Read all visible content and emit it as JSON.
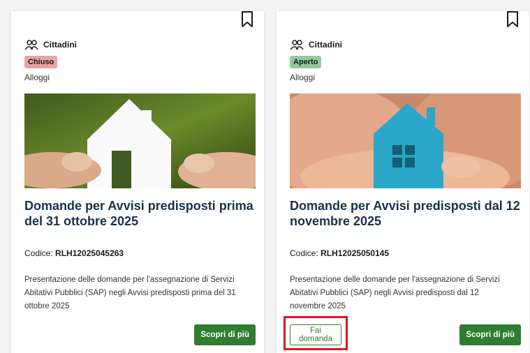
{
  "colors": {
    "primary": "#2e7d32",
    "title": "#17324d",
    "closed_badge": "#e9a3a6",
    "open_badge": "#95c99c",
    "highlight": "#e2141d"
  },
  "cards": [
    {
      "category": "Cittadini",
      "status": "Chiuso",
      "topic": "Alloggi",
      "title": "Domande per Avvisi predisposti prima del 31 ottobre 2025",
      "code_label": "Codice:",
      "code_value": "RLH12025045263",
      "description": "Presentazione delle domande per l'assegnazione di Servizi Abitativi Pubblici (SAP) negli Avvisi predisposti prima del 31 ottobre 2025",
      "more_label": "Scopri di più",
      "icons": {
        "bookmark": "bookmark-icon",
        "category": "people-icon"
      }
    },
    {
      "category": "Cittadini",
      "status": "Aperto",
      "topic": "Alloggi",
      "title": "Domande per Avvisi predisposti dal 12 novembre 2025",
      "code_label": "Codice:",
      "code_value": "RLH12025050145",
      "description": "Presentazione delle domande per l'assegnazione di Servizi Abitativi Pubblici (SAP) negli Avvisi predisposti dal 12 novembre 2025",
      "apply_label": "Fai domanda",
      "more_label": "Scopri di più",
      "icons": {
        "bookmark": "bookmark-icon",
        "category": "people-icon"
      }
    }
  ]
}
